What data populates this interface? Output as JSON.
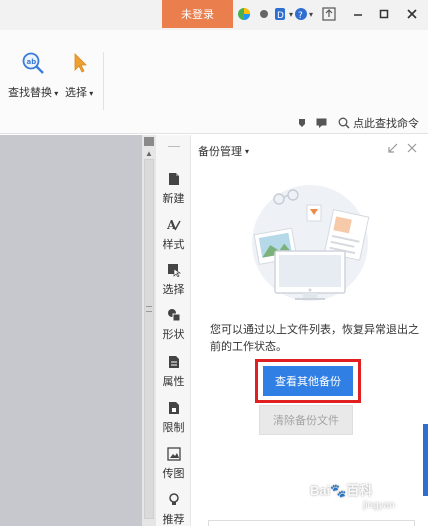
{
  "titlebar": {
    "login_label": "未登录"
  },
  "ribbon": {
    "find_replace_label": "查找替换",
    "select_label": "选择",
    "search_cmd_label": "点此查找命令"
  },
  "sidebar": {
    "items": [
      {
        "label": "新建",
        "icon": "new-doc-icon"
      },
      {
        "label": "样式",
        "icon": "style-icon"
      },
      {
        "label": "选择",
        "icon": "select-icon"
      },
      {
        "label": "形状",
        "icon": "shape-icon"
      },
      {
        "label": "属性",
        "icon": "properties-icon"
      },
      {
        "label": "限制",
        "icon": "restrict-icon"
      },
      {
        "label": "传图",
        "icon": "upload-image-icon"
      },
      {
        "label": "推荐",
        "icon": "recommend-icon"
      }
    ]
  },
  "panel": {
    "title": "备份管理",
    "description": "您可以通过以上文件列表，恢复异常退出之前的工作状态。",
    "view_other_label": "查看其他备份",
    "clear_label": "清除备份文件"
  },
  "colors": {
    "login_bg": "#ea7f4d",
    "primary": "#2f7fe4",
    "highlight_border": "#e02020",
    "doc_bg": "#c7c8cd"
  }
}
